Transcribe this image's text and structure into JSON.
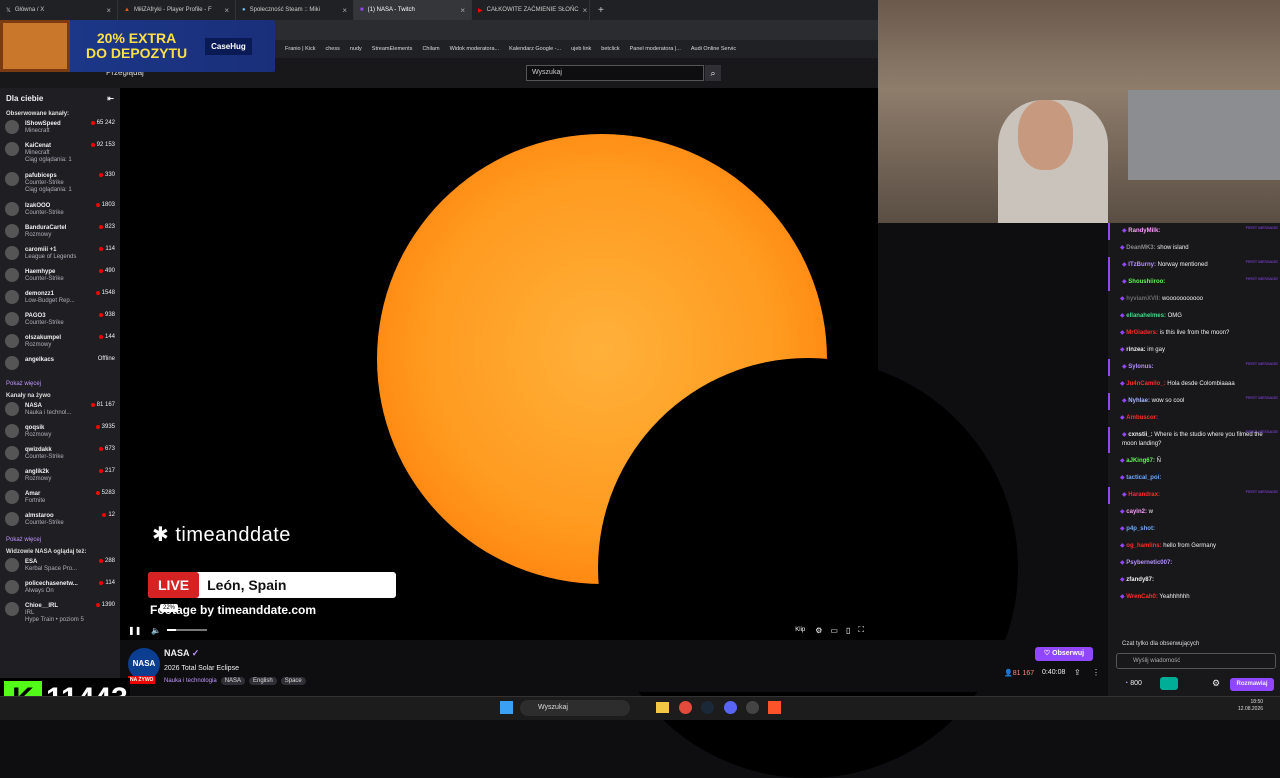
{
  "tabs": [
    {
      "label": "Główna / X"
    },
    {
      "label": "MiłiZAfryki - Player Profile - F"
    },
    {
      "label": "Społeczność Steam :: Miki"
    },
    {
      "label": "(1) NASA - Twitch",
      "active": true
    },
    {
      "label": "CAŁKOWITE ZAĆMIENIE SŁOŃC"
    }
  ],
  "bookmarks": [
    "Franio | Kick",
    "chess",
    "nudy",
    "StreamElements",
    "Chilam",
    "Widok moderatora...",
    "Kalendarz Google -...",
    "ujeb link",
    "betclick",
    "Panel moderatora |...",
    "Audi Online Servic"
  ],
  "ad": {
    "line1": "20% EXTRA",
    "line2": "DO DEPOZYTU",
    "brand": "CaseHug"
  },
  "nav": {
    "browse": "Przeglądaj"
  },
  "search": {
    "placeholder": "Wyszukaj"
  },
  "sidebar": {
    "title": "Dla ciebie",
    "followed_title": "Obserwowane kanały:",
    "followed": [
      {
        "name": "IShowSpeed",
        "game": "Minecraft",
        "viewers": "65 242"
      },
      {
        "name": "KaiCenat",
        "game": "Minecraft",
        "extra": "Ciąg oglądania: 1",
        "viewers": "92 153"
      },
      {
        "name": "pafubiceps",
        "game": "Counter-Strike",
        "extra": "Ciąg oglądania: 1",
        "viewers": "330"
      },
      {
        "name": "IzakOOO",
        "game": "Counter-Strike",
        "viewers": "1803"
      },
      {
        "name": "BanduraCartel",
        "game": "Rozmowy",
        "viewers": "823"
      },
      {
        "name": "caromiii +1",
        "game": "League of Legends",
        "viewers": "114"
      },
      {
        "name": "Haemhype",
        "game": "Counter-Strike",
        "viewers": "490"
      },
      {
        "name": "demonzz1",
        "game": "Low-Budget Rep...",
        "viewers": "1548"
      },
      {
        "name": "PAGO3",
        "game": "Counter-Strike",
        "viewers": "938"
      },
      {
        "name": "olszakumpel",
        "game": "Rozmowy",
        "viewers": "144"
      },
      {
        "name": "angelkacs",
        "game": "",
        "viewers": "Offline"
      }
    ],
    "show_more": "Pokaż więcej",
    "live_title": "Kanały na żywo",
    "live": [
      {
        "name": "NASA",
        "game": "Nauka i technol...",
        "viewers": "81 167"
      },
      {
        "name": "qoqsik",
        "game": "Rozmowy",
        "viewers": "3935"
      },
      {
        "name": "qwizdakk",
        "game": "Counter-Strike",
        "viewers": "673"
      },
      {
        "name": "anglik2k",
        "game": "Rozmowy",
        "viewers": "217"
      },
      {
        "name": "Amar",
        "game": "Fortnite",
        "viewers": "5283"
      },
      {
        "name": "almstaroo",
        "game": "Counter-Strike",
        "viewers": "12"
      }
    ],
    "show_more2": "Pokaż więcej",
    "viewers_title": "Widzowie NASA oglądaj też:",
    "also": [
      {
        "name": "ESA",
        "game": "Kerbal Space Pro...",
        "viewers": "288"
      },
      {
        "name": "policechasenetw...",
        "game": "Always On",
        "viewers": "114"
      },
      {
        "name": "Chioe__IRL",
        "game": "IRL",
        "extra": "Hype Train • poziom 5",
        "viewers": "1390"
      }
    ]
  },
  "player": {
    "brand": "timeanddate",
    "live": "LIVE",
    "location": "León, Spain",
    "footage": "Footage by timeanddate.com",
    "volume": "22%",
    "clip": "Klip"
  },
  "stream": {
    "channel": "NASA",
    "title": "2026 Total Solar Eclipse",
    "category": "Nauka i technologia",
    "tags": [
      "NASA",
      "English",
      "Space"
    ],
    "live_badge": "NA ŻYWO",
    "follow": "Obserwuj",
    "viewers": "81 167",
    "uptime": "0:40:08"
  },
  "chat": {
    "messages": [
      {
        "user": "RandyMilk:",
        "text": "",
        "color": "#ff9dff",
        "first": true
      },
      {
        "user": "DeanMK3:",
        "text": "show island",
        "color": "#8a8a8a"
      },
      {
        "user": "ITzBurny:",
        "text": "Norway mentioned",
        "color": "#b691ff",
        "first": true
      },
      {
        "user": "Shoushiiroo:",
        "text": "",
        "color": "#64f55a",
        "first": true
      },
      {
        "user": "hyviamXVII:",
        "text": "wooooooooooo",
        "color": "#6b6b6b"
      },
      {
        "user": "ellanahelmes:",
        "text": "OMG",
        "color": "#3cde8a"
      },
      {
        "user": "MrGladers:",
        "text": "is this live from the moon?",
        "color": "#ff2a2a"
      },
      {
        "user": "rinzea:",
        "text": "im gay",
        "color": "#efeff1"
      },
      {
        "user": "Sylonus:",
        "text": "",
        "color": "#b691ff",
        "first": true
      },
      {
        "user": "Ju4nCamilo_:",
        "text": "Hola desde Colombiaaaa",
        "color": "#ff2a2a"
      },
      {
        "user": "Nyhlae:",
        "text": "wow so cool",
        "color": "#a6b7ff",
        "first": true
      },
      {
        "user": "Ambuscor:",
        "text": "",
        "color": "#ff2a2a"
      },
      {
        "user": "cxnstii_:",
        "text": "Where is the studio where you filmed the moon landing?",
        "color": "#efeff1",
        "first": true
      },
      {
        "user": "aJKing67:",
        "text": "Ñ",
        "color": "#64f55a"
      },
      {
        "user": "tactical_poi:",
        "text": "",
        "color": "#6ba8ff"
      },
      {
        "user": "Harandrax:",
        "text": "",
        "color": "#ff2a2a",
        "first": true
      },
      {
        "user": "cayin2:",
        "text": "w",
        "color": "#ff9dff"
      },
      {
        "user": "p4p_shot:",
        "text": "",
        "color": "#6ba8ff"
      },
      {
        "user": "og_hamlins:",
        "text": "hello from Germany",
        "color": "#ff2a2a"
      },
      {
        "user": "Psybernetic007:",
        "text": "",
        "color": "#b691ff"
      },
      {
        "user": "zfandy87:",
        "text": "",
        "color": "#efeff1"
      },
      {
        "user": "WrenCah0:",
        "text": "Yeahhhhhh",
        "color": "#ff2a2a"
      }
    ],
    "first_label": "FIRST MESSAGE",
    "sub_only": "Czat tylko dla obserwujących",
    "input_placeholder": "Wyślij wiadomość",
    "points": "800",
    "chat_button": "Rozmawiaj"
  },
  "overlay": {
    "kick_count": "11443",
    "kick_letter": "K"
  },
  "taskbar": {
    "search": "Wyszukaj",
    "time": "18:50",
    "date": "12.08.2026"
  }
}
